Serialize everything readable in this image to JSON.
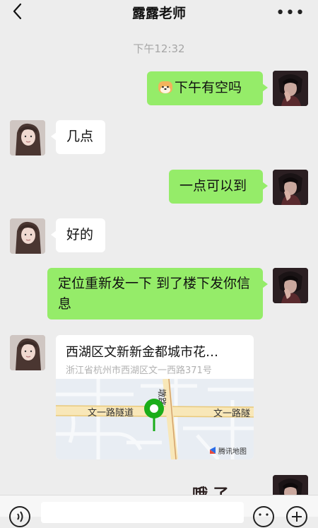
{
  "header": {
    "title": "露露老师",
    "back_icon": "chevron-left-icon",
    "more_label": "•••"
  },
  "chat": {
    "timestamp": "下午12:32",
    "messages": [
      {
        "from": "me",
        "text": "下午有空吗",
        "emoji": "shiba-dog-emoji"
      },
      {
        "from": "her",
        "text": "几点"
      },
      {
        "from": "me",
        "text": "一点可以到"
      },
      {
        "from": "her",
        "text": "好的"
      },
      {
        "from": "me",
        "text": "定位重新发一下 到了楼下发你信息"
      },
      {
        "from": "her",
        "type": "location"
      },
      {
        "from": "me",
        "text_partial": "哦 了"
      }
    ],
    "location": {
      "title": "西湖区文新新金都城市花…",
      "address": "浙江省杭州市西湖区文一西路371号",
      "road_label_left": "文一路隧道",
      "road_label_right": "文一路隧",
      "road_label_vertical": "墩路",
      "map_provider": "腾讯地图"
    }
  },
  "colors": {
    "me_bubble": "#95ec69",
    "her_bubble": "#ffffff",
    "background": "#ededed",
    "pin": "#1aad19"
  }
}
